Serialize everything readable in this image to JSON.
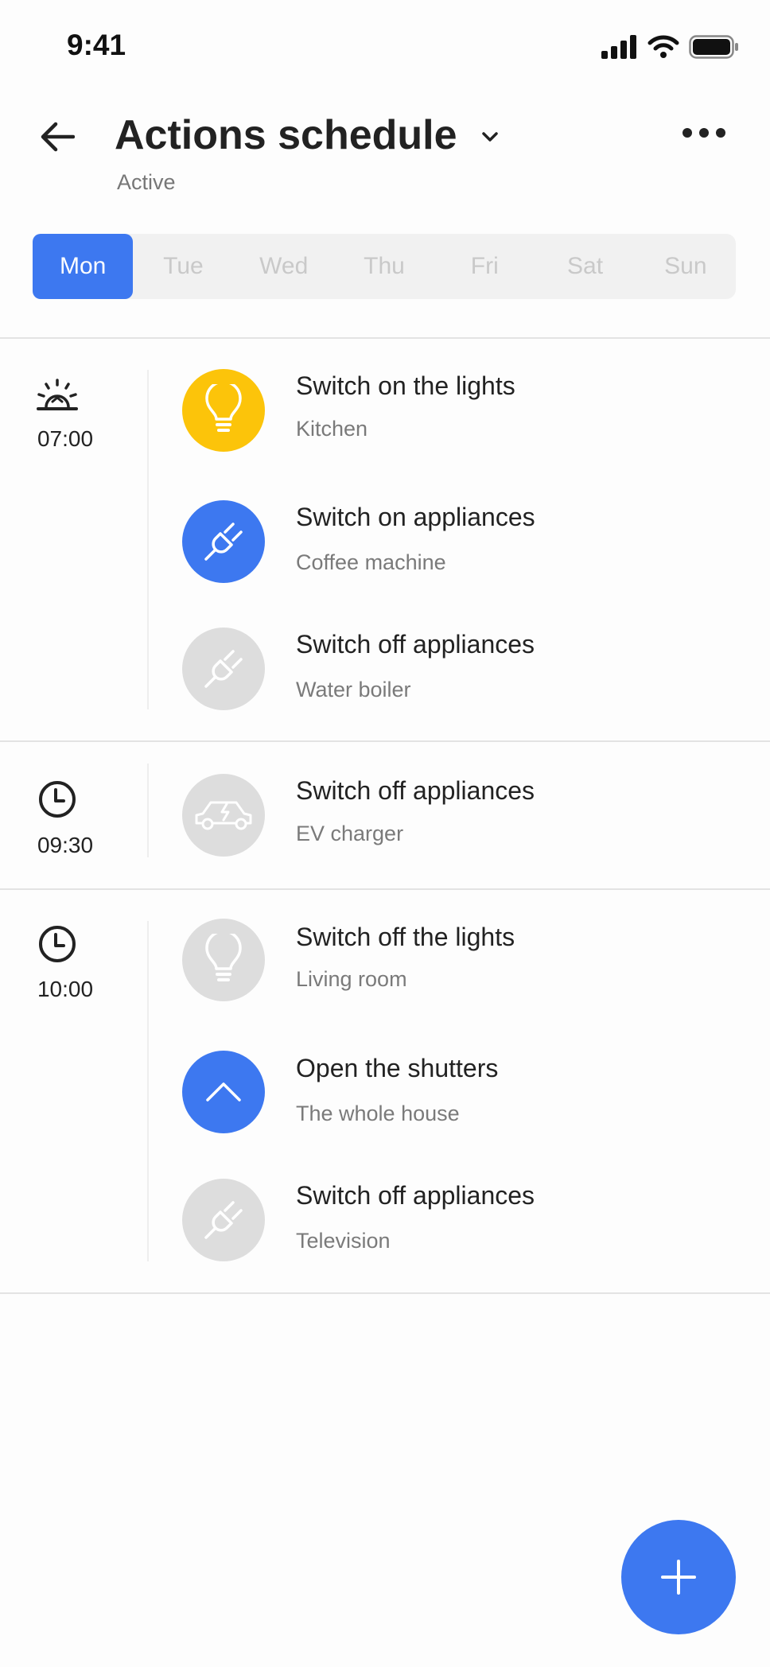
{
  "status_bar": {
    "time": "9:41"
  },
  "header": {
    "title": "Actions schedule",
    "status": "Active"
  },
  "days": [
    {
      "label": "Mon",
      "active": true
    },
    {
      "label": "Tue"
    },
    {
      "label": "Wed"
    },
    {
      "label": "Thu"
    },
    {
      "label": "Fri"
    },
    {
      "label": "Sat"
    },
    {
      "label": "Sun"
    }
  ],
  "colors": {
    "accent": "#3d78f0",
    "light": "#fcc40a",
    "inactive": "#dddddd"
  },
  "groups": [
    {
      "time": "07:00",
      "icon": "sunrise-icon",
      "items": [
        {
          "title": "Switch on the lights",
          "subtitle": "Kitchen",
          "icon": "lightbulb-icon",
          "state": "on-yellow"
        },
        {
          "title": "Switch on appliances",
          "subtitle": "Coffee machine",
          "icon": "plug-icon",
          "state": "on-blue"
        },
        {
          "title": "Switch off appliances",
          "subtitle": "Water boiler",
          "icon": "plug-icon",
          "state": "off"
        }
      ]
    },
    {
      "time": "09:30",
      "icon": "clock-icon",
      "items": [
        {
          "title": "Switch off appliances",
          "subtitle": "EV charger",
          "icon": "ev-car-icon",
          "state": "off"
        }
      ]
    },
    {
      "time": "10:00",
      "icon": "clock-icon",
      "items": [
        {
          "title": "Switch off the lights",
          "subtitle": "Living room",
          "icon": "lightbulb-icon",
          "state": "off"
        },
        {
          "title": "Open the shutters",
          "subtitle": "The whole house",
          "icon": "chevron-up-icon",
          "state": "on-blue"
        },
        {
          "title": "Switch off appliances",
          "subtitle": "Television",
          "icon": "plug-icon",
          "state": "off"
        }
      ]
    }
  ]
}
